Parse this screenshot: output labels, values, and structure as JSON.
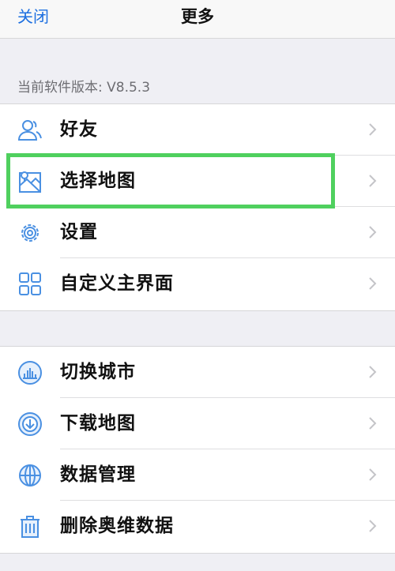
{
  "nav": {
    "close_label": "关闭",
    "title": "更多"
  },
  "version_label": "当前软件版本: V8.5.3",
  "group1": [
    {
      "label": "好友",
      "icon": "friends-icon"
    },
    {
      "label": "选择地图",
      "icon": "map-icon"
    },
    {
      "label": "设置",
      "icon": "gear-icon"
    },
    {
      "label": "自定义主界面",
      "icon": "layout-grid-icon"
    }
  ],
  "group2": [
    {
      "label": "切换城市",
      "icon": "city-skyline-icon"
    },
    {
      "label": "下载地图",
      "icon": "download-icon"
    },
    {
      "label": "数据管理",
      "icon": "globe-icon"
    },
    {
      "label": "删除奥维数据",
      "icon": "trash-icon"
    }
  ],
  "colors": {
    "accent": "#1d6fe0",
    "icon_blue": "#4a90e2",
    "highlight": "#4fd05e"
  }
}
